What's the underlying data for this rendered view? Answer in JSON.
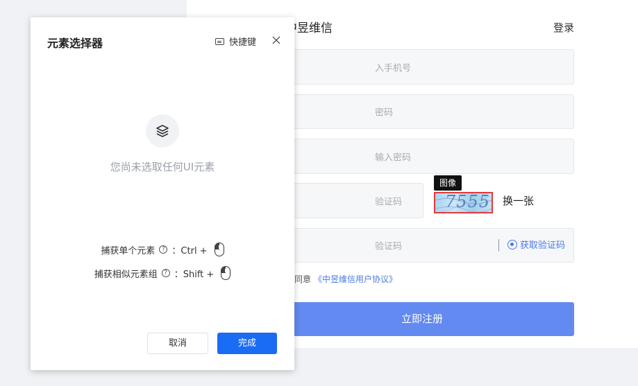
{
  "register": {
    "title": "中昱维信",
    "login_label": "登录",
    "phone_placeholder": "入手机号",
    "password_placeholder": "密码",
    "confirm_placeholder": "输入密码",
    "captcha_placeholder": "验证码",
    "captcha_value": "7555",
    "captcha_tag": "图像",
    "refresh_label": "换一张",
    "sms_placeholder": "验证码",
    "sms_button": "获取验证码",
    "agree_text": "同意",
    "agreement_link": "《中昱维信用户协议》",
    "submit_label": "立即注册"
  },
  "dialog": {
    "title": "元素选择器",
    "shortcut_label": "快捷键",
    "empty_text": "您尚未选取任何UI元素",
    "hint_single_label": "捕获单个元素",
    "hint_single_keys": "：Ctrl +",
    "hint_group_label": "捕获相似元素组",
    "hint_group_keys": "：Shift +",
    "cancel_label": "取消",
    "done_label": "完成"
  },
  "colors": {
    "primary": "#1a6cf5",
    "submit": "#628af0",
    "captcha_border": "#e4393c"
  }
}
